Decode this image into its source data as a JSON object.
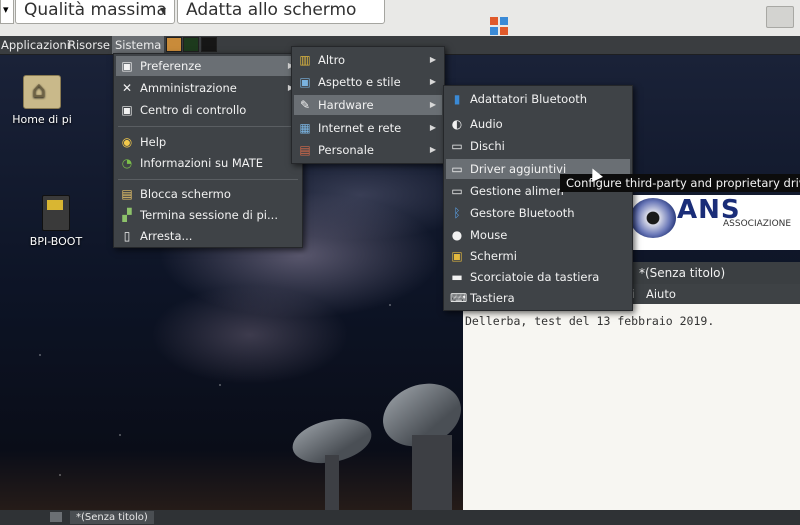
{
  "viewer": {
    "quality_value": "Qualità massima",
    "scale_value": "Adatta allo schermo"
  },
  "panel": {
    "menus": [
      "Applicazioni",
      "Risorse",
      "Sistema"
    ]
  },
  "desktop": {
    "icons": [
      {
        "label": "Home di pi",
        "icon": "home-folder-icon"
      },
      {
        "label": "BPI-BOOT",
        "icon": "drive-icon"
      }
    ]
  },
  "sistema_menu": {
    "items": [
      {
        "label": "Preferenze",
        "icon": "preferences-icon",
        "submenu": true
      },
      {
        "label": "Amministrazione",
        "icon": "tools-icon",
        "submenu": true
      },
      {
        "label": "Centro di controllo",
        "icon": "control-center-icon",
        "submenu": false
      },
      {
        "label": "Help",
        "icon": "help-icon",
        "submenu": false
      },
      {
        "label": "Informazioni su MATE",
        "icon": "mate-icon",
        "submenu": false
      },
      {
        "label": "Blocca schermo",
        "icon": "lock-screen-icon",
        "submenu": false
      },
      {
        "label": "Termina sessione di pi...",
        "icon": "logout-icon",
        "submenu": false
      },
      {
        "label": "Arresta...",
        "icon": "shutdown-icon",
        "submenu": false
      }
    ]
  },
  "preferenze_menu": {
    "items": [
      {
        "label": "Altro",
        "icon": "other-icon",
        "submenu": true
      },
      {
        "label": "Aspetto e stile",
        "icon": "appearance-icon",
        "submenu": true
      },
      {
        "label": "Hardware",
        "icon": "hardware-icon",
        "submenu": true
      },
      {
        "label": "Internet e rete",
        "icon": "network-icon",
        "submenu": true
      },
      {
        "label": "Personale",
        "icon": "personal-icon",
        "submenu": true
      }
    ]
  },
  "hardware_menu": {
    "items": [
      {
        "label": "Adattatori Bluetooth",
        "icon": "bluetooth-icon"
      },
      {
        "label": "Audio",
        "icon": "audio-icon"
      },
      {
        "label": "Dischi",
        "icon": "disk-icon"
      },
      {
        "label": "Driver aggiuntivi",
        "icon": "driver-icon"
      },
      {
        "label": "Gestione alimen",
        "icon": "power-icon"
      },
      {
        "label": "Gestore Bluetooth",
        "icon": "bluetooth-manager-icon"
      },
      {
        "label": "Mouse",
        "icon": "mouse-icon"
      },
      {
        "label": "Schermi",
        "icon": "display-icon"
      },
      {
        "label": "Scorciatoie da tastiera",
        "icon": "shortcut-icon"
      },
      {
        "label": "Tastiera",
        "icon": "keyboard-icon"
      }
    ]
  },
  "tooltip": "Configure third-party and proprietary drive",
  "bg_window": {
    "title": "*(Senza titolo)",
    "menu_items": [
      "oni",
      "Aiuto"
    ],
    "text": "Dellerba, test del 13 febbraio 2019."
  },
  "logo": {
    "text": "ANS",
    "subtitle": "ASSOCIAZIONE"
  },
  "taskbar": {
    "button": "*(Senza titolo)"
  },
  "colors": {
    "panel": "#3a3d40",
    "menu": "#3f4347",
    "highlight": "#6a6f74",
    "tooltip": "#0c0c0c"
  }
}
